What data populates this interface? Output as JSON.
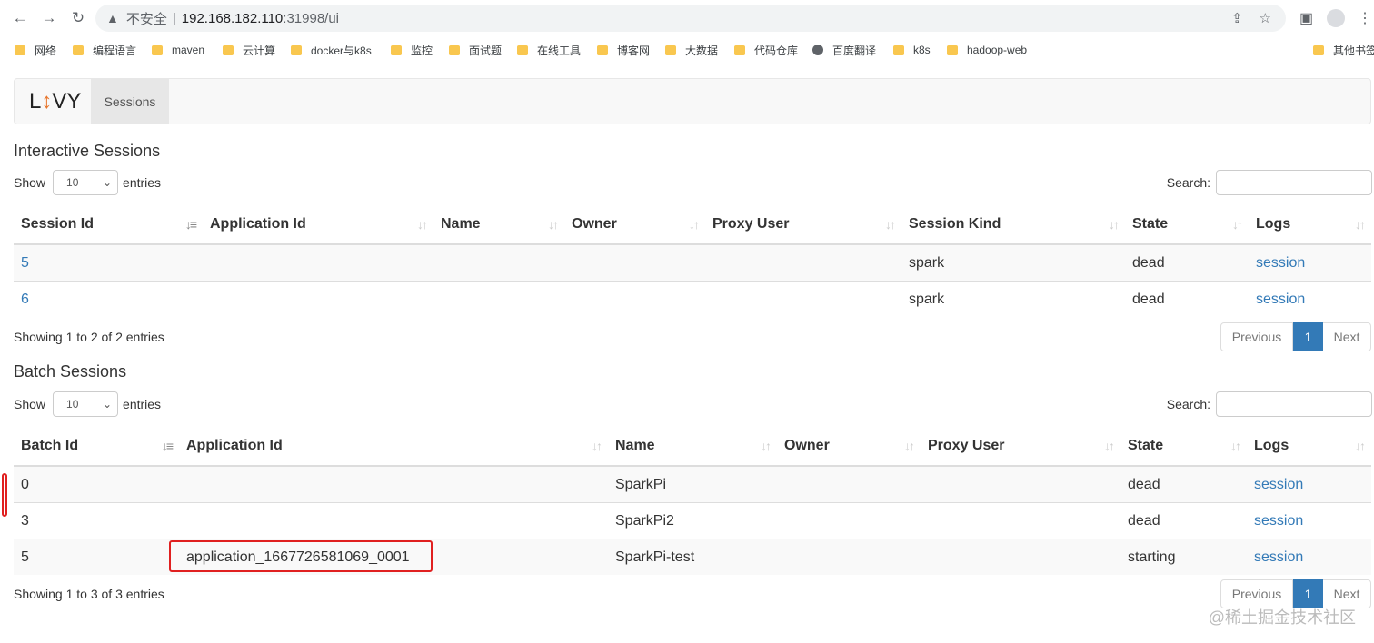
{
  "browser": {
    "insecure_label": "不安全",
    "url_host": "192.168.182.110",
    "url_rest": ":31998/ui",
    "bookmarks": [
      "网络",
      "编程语言",
      "maven",
      "云计算",
      "docker与k8s",
      "监控",
      "面试题",
      "在线工具",
      "博客网",
      "大数据",
      "代码仓库",
      "百度翻译",
      "k8s",
      "hadoop-web"
    ],
    "other_bookmarks": "其他书签"
  },
  "navbar": {
    "brand_pre": "L",
    "brand_arrow": "↕",
    "brand_post": "VY",
    "tab": "Sessions"
  },
  "interactive": {
    "title": "Interactive Sessions",
    "show_label": "Show",
    "page_size": "10",
    "entries_label": "entries",
    "search_label": "Search:",
    "columns": [
      "Session Id",
      "Application Id",
      "Name",
      "Owner",
      "Proxy User",
      "Session Kind",
      "State",
      "Logs"
    ],
    "rows": [
      {
        "id": "5",
        "app": "",
        "name": "",
        "owner": "",
        "proxy": "",
        "kind": "spark",
        "state": "dead",
        "logs": "session"
      },
      {
        "id": "6",
        "app": "",
        "name": "",
        "owner": "",
        "proxy": "",
        "kind": "spark",
        "state": "dead",
        "logs": "session"
      }
    ],
    "info": "Showing 1 to 2 of 2 entries",
    "prev": "Previous",
    "page": "1",
    "next": "Next"
  },
  "batch": {
    "title": "Batch Sessions",
    "show_label": "Show",
    "page_size": "10",
    "entries_label": "entries",
    "search_label": "Search:",
    "columns": [
      "Batch Id",
      "Application Id",
      "Name",
      "Owner",
      "Proxy User",
      "State",
      "Logs"
    ],
    "rows": [
      {
        "id": "0",
        "app": "",
        "name": "SparkPi",
        "owner": "",
        "proxy": "",
        "state": "dead",
        "logs": "session"
      },
      {
        "id": "3",
        "app": "",
        "name": "SparkPi2",
        "owner": "",
        "proxy": "",
        "state": "dead",
        "logs": "session"
      },
      {
        "id": "5",
        "app": "application_1667726581069_0001",
        "name": "SparkPi-test",
        "owner": "",
        "proxy": "",
        "state": "starting",
        "logs": "session"
      }
    ],
    "info": "Showing 1 to 3 of 3 entries",
    "prev": "Previous",
    "page": "1",
    "next": "Next"
  },
  "watermark": "@稀土掘金技术社区"
}
